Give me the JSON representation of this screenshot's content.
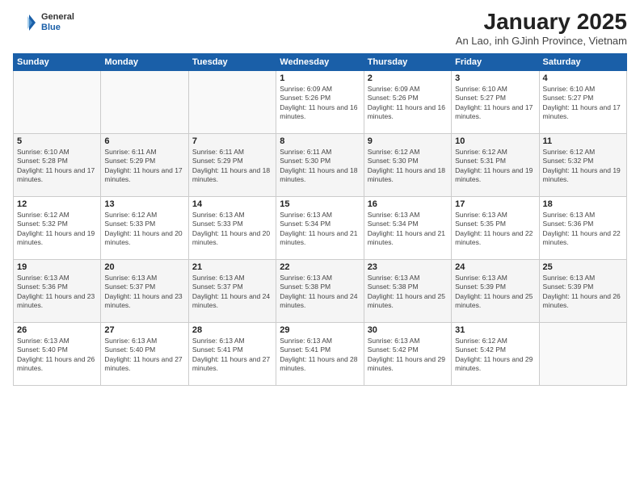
{
  "logo": {
    "line1": "General",
    "line2": "Blue"
  },
  "title": "January 2025",
  "subtitle": "An Lao, inh GJinh Province, Vietnam",
  "days_of_week": [
    "Sunday",
    "Monday",
    "Tuesday",
    "Wednesday",
    "Thursday",
    "Friday",
    "Saturday"
  ],
  "weeks": [
    [
      {
        "num": "",
        "sunrise": "",
        "sunset": "",
        "daylight": ""
      },
      {
        "num": "",
        "sunrise": "",
        "sunset": "",
        "daylight": ""
      },
      {
        "num": "",
        "sunrise": "",
        "sunset": "",
        "daylight": ""
      },
      {
        "num": "1",
        "sunrise": "Sunrise: 6:09 AM",
        "sunset": "Sunset: 5:26 PM",
        "daylight": "Daylight: 11 hours and 16 minutes."
      },
      {
        "num": "2",
        "sunrise": "Sunrise: 6:09 AM",
        "sunset": "Sunset: 5:26 PM",
        "daylight": "Daylight: 11 hours and 16 minutes."
      },
      {
        "num": "3",
        "sunrise": "Sunrise: 6:10 AM",
        "sunset": "Sunset: 5:27 PM",
        "daylight": "Daylight: 11 hours and 17 minutes."
      },
      {
        "num": "4",
        "sunrise": "Sunrise: 6:10 AM",
        "sunset": "Sunset: 5:27 PM",
        "daylight": "Daylight: 11 hours and 17 minutes."
      }
    ],
    [
      {
        "num": "5",
        "sunrise": "Sunrise: 6:10 AM",
        "sunset": "Sunset: 5:28 PM",
        "daylight": "Daylight: 11 hours and 17 minutes."
      },
      {
        "num": "6",
        "sunrise": "Sunrise: 6:11 AM",
        "sunset": "Sunset: 5:29 PM",
        "daylight": "Daylight: 11 hours and 17 minutes."
      },
      {
        "num": "7",
        "sunrise": "Sunrise: 6:11 AM",
        "sunset": "Sunset: 5:29 PM",
        "daylight": "Daylight: 11 hours and 18 minutes."
      },
      {
        "num": "8",
        "sunrise": "Sunrise: 6:11 AM",
        "sunset": "Sunset: 5:30 PM",
        "daylight": "Daylight: 11 hours and 18 minutes."
      },
      {
        "num": "9",
        "sunrise": "Sunrise: 6:12 AM",
        "sunset": "Sunset: 5:30 PM",
        "daylight": "Daylight: 11 hours and 18 minutes."
      },
      {
        "num": "10",
        "sunrise": "Sunrise: 6:12 AM",
        "sunset": "Sunset: 5:31 PM",
        "daylight": "Daylight: 11 hours and 19 minutes."
      },
      {
        "num": "11",
        "sunrise": "Sunrise: 6:12 AM",
        "sunset": "Sunset: 5:32 PM",
        "daylight": "Daylight: 11 hours and 19 minutes."
      }
    ],
    [
      {
        "num": "12",
        "sunrise": "Sunrise: 6:12 AM",
        "sunset": "Sunset: 5:32 PM",
        "daylight": "Daylight: 11 hours and 19 minutes."
      },
      {
        "num": "13",
        "sunrise": "Sunrise: 6:12 AM",
        "sunset": "Sunset: 5:33 PM",
        "daylight": "Daylight: 11 hours and 20 minutes."
      },
      {
        "num": "14",
        "sunrise": "Sunrise: 6:13 AM",
        "sunset": "Sunset: 5:33 PM",
        "daylight": "Daylight: 11 hours and 20 minutes."
      },
      {
        "num": "15",
        "sunrise": "Sunrise: 6:13 AM",
        "sunset": "Sunset: 5:34 PM",
        "daylight": "Daylight: 11 hours and 21 minutes."
      },
      {
        "num": "16",
        "sunrise": "Sunrise: 6:13 AM",
        "sunset": "Sunset: 5:34 PM",
        "daylight": "Daylight: 11 hours and 21 minutes."
      },
      {
        "num": "17",
        "sunrise": "Sunrise: 6:13 AM",
        "sunset": "Sunset: 5:35 PM",
        "daylight": "Daylight: 11 hours and 22 minutes."
      },
      {
        "num": "18",
        "sunrise": "Sunrise: 6:13 AM",
        "sunset": "Sunset: 5:36 PM",
        "daylight": "Daylight: 11 hours and 22 minutes."
      }
    ],
    [
      {
        "num": "19",
        "sunrise": "Sunrise: 6:13 AM",
        "sunset": "Sunset: 5:36 PM",
        "daylight": "Daylight: 11 hours and 23 minutes."
      },
      {
        "num": "20",
        "sunrise": "Sunrise: 6:13 AM",
        "sunset": "Sunset: 5:37 PM",
        "daylight": "Daylight: 11 hours and 23 minutes."
      },
      {
        "num": "21",
        "sunrise": "Sunrise: 6:13 AM",
        "sunset": "Sunset: 5:37 PM",
        "daylight": "Daylight: 11 hours and 24 minutes."
      },
      {
        "num": "22",
        "sunrise": "Sunrise: 6:13 AM",
        "sunset": "Sunset: 5:38 PM",
        "daylight": "Daylight: 11 hours and 24 minutes."
      },
      {
        "num": "23",
        "sunrise": "Sunrise: 6:13 AM",
        "sunset": "Sunset: 5:38 PM",
        "daylight": "Daylight: 11 hours and 25 minutes."
      },
      {
        "num": "24",
        "sunrise": "Sunrise: 6:13 AM",
        "sunset": "Sunset: 5:39 PM",
        "daylight": "Daylight: 11 hours and 25 minutes."
      },
      {
        "num": "25",
        "sunrise": "Sunrise: 6:13 AM",
        "sunset": "Sunset: 5:39 PM",
        "daylight": "Daylight: 11 hours and 26 minutes."
      }
    ],
    [
      {
        "num": "26",
        "sunrise": "Sunrise: 6:13 AM",
        "sunset": "Sunset: 5:40 PM",
        "daylight": "Daylight: 11 hours and 26 minutes."
      },
      {
        "num": "27",
        "sunrise": "Sunrise: 6:13 AM",
        "sunset": "Sunset: 5:40 PM",
        "daylight": "Daylight: 11 hours and 27 minutes."
      },
      {
        "num": "28",
        "sunrise": "Sunrise: 6:13 AM",
        "sunset": "Sunset: 5:41 PM",
        "daylight": "Daylight: 11 hours and 27 minutes."
      },
      {
        "num": "29",
        "sunrise": "Sunrise: 6:13 AM",
        "sunset": "Sunset: 5:41 PM",
        "daylight": "Daylight: 11 hours and 28 minutes."
      },
      {
        "num": "30",
        "sunrise": "Sunrise: 6:13 AM",
        "sunset": "Sunset: 5:42 PM",
        "daylight": "Daylight: 11 hours and 29 minutes."
      },
      {
        "num": "31",
        "sunrise": "Sunrise: 6:12 AM",
        "sunset": "Sunset: 5:42 PM",
        "daylight": "Daylight: 11 hours and 29 minutes."
      },
      {
        "num": "",
        "sunrise": "",
        "sunset": "",
        "daylight": ""
      }
    ]
  ]
}
